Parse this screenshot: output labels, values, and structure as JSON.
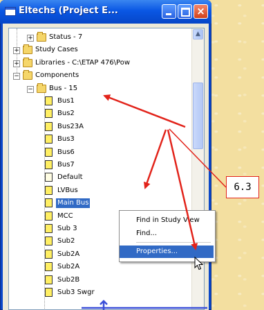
{
  "window": {
    "title": "Eltechs (Project E...",
    "buttons": {
      "minimize": "minimize",
      "maximize": "maximize",
      "close": "×"
    }
  },
  "tree": {
    "items": [
      {
        "label": "Status - 7",
        "level": 2,
        "expander": "+",
        "icon": "folder"
      },
      {
        "label": "Study Cases",
        "level": 1,
        "expander": "+",
        "icon": "folder"
      },
      {
        "label": "Libraries - C:\\ETAP 476\\Pow",
        "level": 1,
        "expander": "+",
        "icon": "folder"
      },
      {
        "label": "Components",
        "level": 1,
        "expander": "−",
        "icon": "folder-open"
      },
      {
        "label": "Bus - 15",
        "level": 2,
        "expander": "−",
        "icon": "folder-open"
      },
      {
        "label": "Bus1",
        "level": 3,
        "icon": "doc-yellow"
      },
      {
        "label": "Bus2",
        "level": 3,
        "icon": "doc-yellow"
      },
      {
        "label": "Bus23A",
        "level": 3,
        "icon": "doc-yellow"
      },
      {
        "label": "Bus3",
        "level": 3,
        "icon": "doc-yellow"
      },
      {
        "label": "Bus6",
        "level": 3,
        "icon": "doc-yellow"
      },
      {
        "label": "Bus7",
        "level": 3,
        "icon": "doc-yellow"
      },
      {
        "label": "Default",
        "level": 3,
        "icon": "doc-white"
      },
      {
        "label": "LVBus",
        "level": 3,
        "icon": "doc-yellow"
      },
      {
        "label": "Main Bus",
        "level": 3,
        "icon": "doc-yellow",
        "selected": true
      },
      {
        "label": "MCC",
        "level": 3,
        "icon": "doc-yellow"
      },
      {
        "label": "Sub 3",
        "level": 3,
        "icon": "doc-yellow"
      },
      {
        "label": "Sub2",
        "level": 3,
        "icon": "doc-yellow"
      },
      {
        "label": "Sub2A",
        "level": 3,
        "icon": "doc-yellow"
      },
      {
        "label": "Sub2A",
        "level": 3,
        "icon": "doc-yellow"
      },
      {
        "label": "Sub2B",
        "level": 3,
        "icon": "doc-yellow"
      },
      {
        "label": "Sub3 Swgr",
        "level": 3,
        "icon": "doc-yellow"
      }
    ]
  },
  "context_menu": {
    "items": [
      "Find in Study View",
      "Find...",
      "Properties..."
    ],
    "highlighted": "Properties..."
  },
  "annotation": {
    "callout": "6.3"
  },
  "colors": {
    "arrow": "#e2231a",
    "selection": "#316ac5",
    "titlebar": "#0a57e4"
  }
}
